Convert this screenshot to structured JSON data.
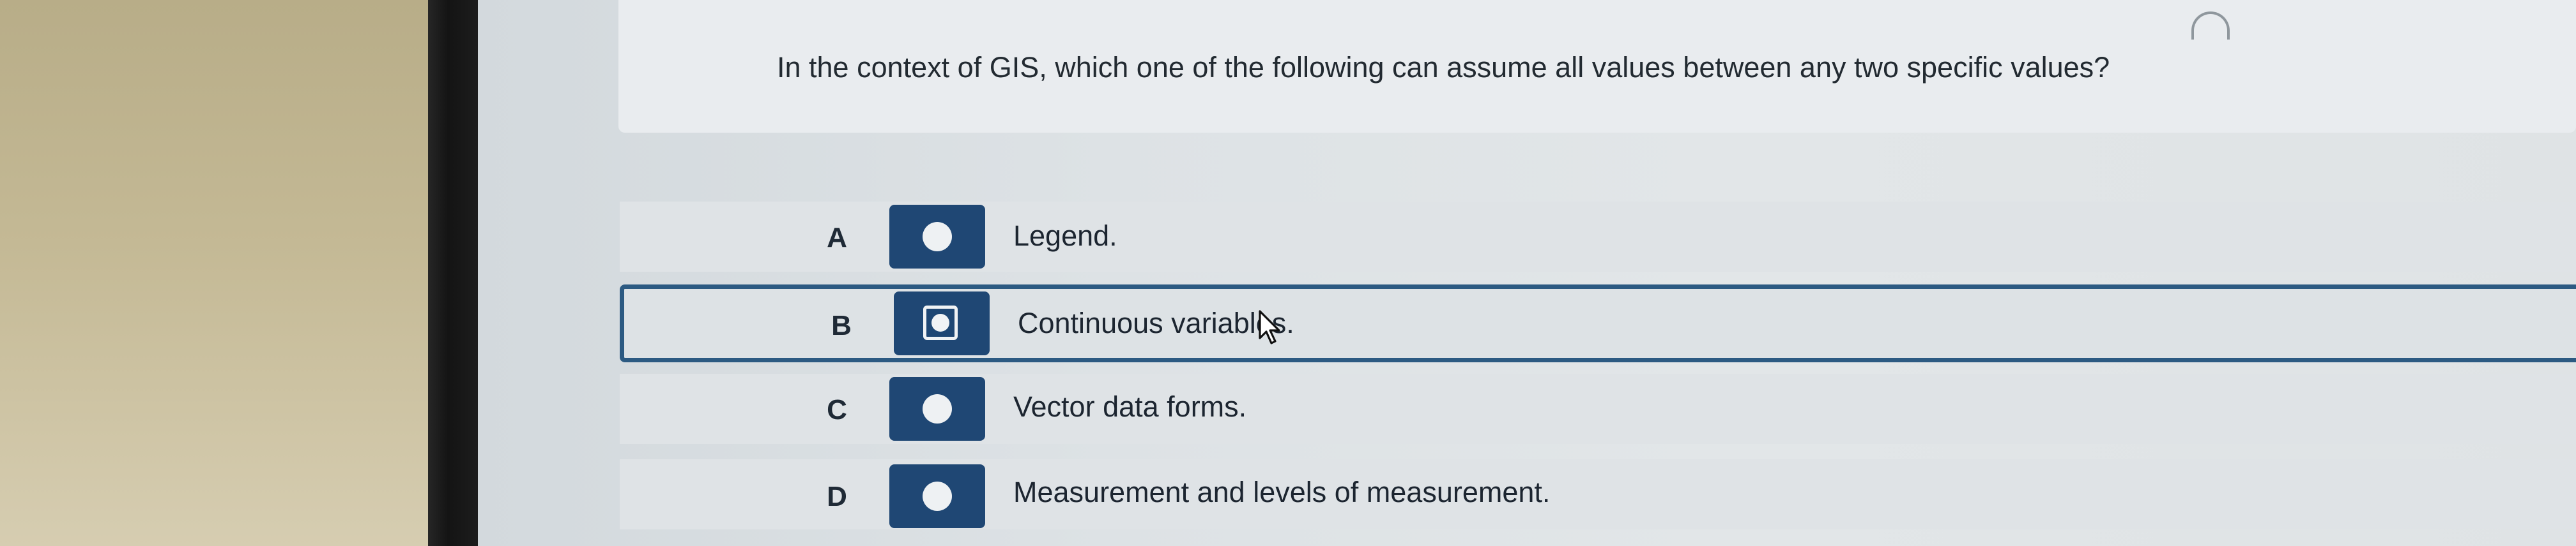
{
  "question": {
    "text": "In the context of GIS, which one of the following can assume all values between any two specific values?"
  },
  "options": [
    {
      "letter": "A",
      "text": "Legend.",
      "selected": false
    },
    {
      "letter": "B",
      "text": "Continuous variables.",
      "selected": true
    },
    {
      "letter": "C",
      "text": "Vector data forms.",
      "selected": false
    },
    {
      "letter": "D",
      "text": "Measurement and levels of measurement.",
      "selected": false
    }
  ],
  "icons": {
    "loader": "loading-arc-icon",
    "pointer": "mouse-pointer-icon",
    "radio": "radio-dot-icon"
  },
  "colors": {
    "accent": "#1f4774",
    "selected_border": "#2c5a82",
    "text": "#222a31"
  }
}
